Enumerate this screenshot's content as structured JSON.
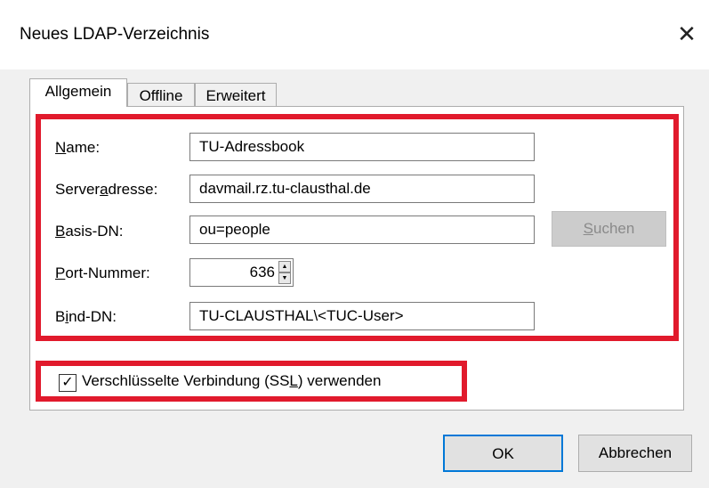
{
  "window": {
    "title": "Neues LDAP-Verzeichnis",
    "close_glyph": "✕"
  },
  "tabs": [
    {
      "label": "Allgemein",
      "active": true
    },
    {
      "label": "Offline",
      "active": false
    },
    {
      "label": "Erweitert",
      "active": false
    }
  ],
  "form": {
    "name": {
      "pre": "",
      "ul": "N",
      "post": "ame:",
      "value": "TU-Adressbook"
    },
    "server": {
      "pre": "Server",
      "ul": "a",
      "post": "dresse:",
      "value": "davmail.rz.tu-clausthal.de"
    },
    "basedn": {
      "pre": "",
      "ul": "B",
      "post": "asis-DN:",
      "value": "ou=people"
    },
    "port": {
      "pre": "",
      "ul": "P",
      "post": "ort-Nummer:",
      "value": "636",
      "spin_up": "▲",
      "spin_down": "▼"
    },
    "binddn": {
      "pre": "B",
      "ul": "i",
      "post": "nd-DN:",
      "value": "TU-CLAUSTHAL\\<TUC-User>"
    },
    "search_button": {
      "pre": "",
      "ul": "S",
      "post": "uchen",
      "enabled": false
    }
  },
  "ssl": {
    "checked": true,
    "check_glyph": "✓",
    "pre": "Verschlüsselte Verbindung (SS",
    "ul": "L",
    "post": ") verwenden"
  },
  "buttons": {
    "ok": "OK",
    "cancel": "Abbrechen"
  },
  "colors": {
    "highlight_red": "#e11a2c",
    "default_button_border": "#0078d7",
    "disabled_button_bg": "#cccccc"
  }
}
